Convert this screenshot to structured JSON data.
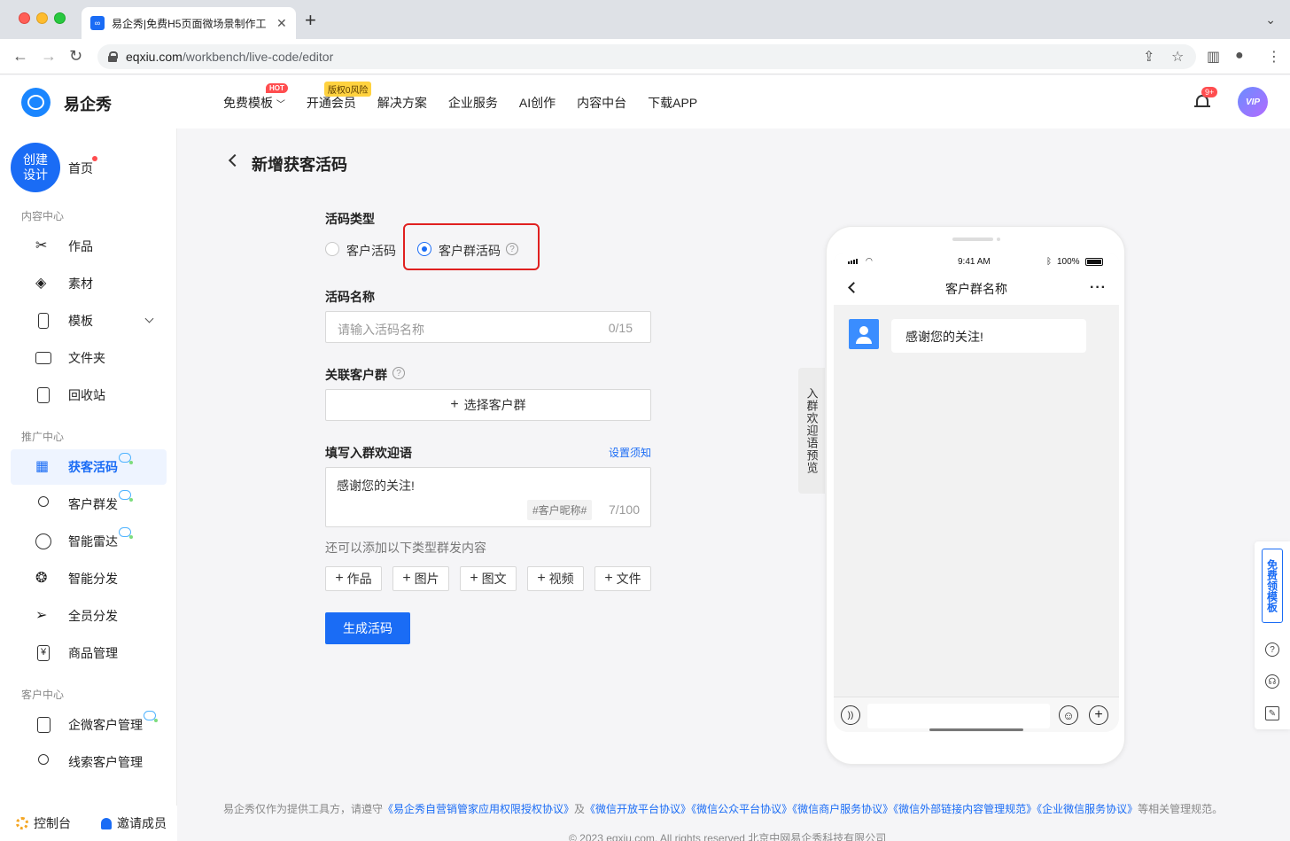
{
  "browser": {
    "tab_title": "易企秀|免费H5页面微场景制作工",
    "favicon_text": "∞",
    "url_host": "eqxiu.com",
    "url_path": "/workbench/live-code/editor"
  },
  "header": {
    "brand": "易企秀",
    "nav": [
      {
        "label": "免费模板",
        "badge": "HOT"
      },
      {
        "label": "开通会员",
        "badge": "版权0风险"
      },
      {
        "label": "解决方案"
      },
      {
        "label": "企业服务"
      },
      {
        "label": "AI创作"
      },
      {
        "label": "内容中台"
      },
      {
        "label": "下载APP"
      }
    ],
    "notification_count": "9+",
    "avatar_text": "VIP"
  },
  "sidebar": {
    "create_button": "创建设计",
    "home": "首页",
    "sections": [
      {
        "title": "内容中心",
        "items": [
          "作品",
          "素材",
          "模板",
          "文件夹",
          "回收站"
        ]
      },
      {
        "title": "推广中心",
        "items": [
          "获客活码",
          "客户群发",
          "智能雷达",
          "智能分发",
          "全员分发",
          "商品管理"
        ]
      },
      {
        "title": "客户中心",
        "items": [
          "企微客户管理",
          "线索客户管理"
        ]
      }
    ],
    "active_item": "获客活码",
    "bottom": {
      "console": "控制台",
      "invite": "邀请成员"
    }
  },
  "form": {
    "page_title": "新增获客活码",
    "code_type_label": "活码类型",
    "code_type_options": [
      "客户活码",
      "客户群活码"
    ],
    "code_type_selected": "客户群活码",
    "name_label": "活码名称",
    "name_placeholder": "请输入活码名称",
    "name_count": "0/15",
    "group_label": "关联客户群",
    "group_button": "选择客户群",
    "welcome_label": "填写入群欢迎语",
    "welcome_link": "设置须知",
    "welcome_value": "感谢您的关注!",
    "nickname_tag": "#客户昵称#",
    "welcome_count": "7/100",
    "hint": "还可以添加以下类型群发内容",
    "add_buttons": [
      "作品",
      "图片",
      "图文",
      "视频",
      "文件"
    ],
    "submit": "生成活码"
  },
  "preview": {
    "tab_label": "入群欢迎语预览",
    "time": "9:41 AM",
    "battery": "100%",
    "chat_title": "客户群名称",
    "message": "感谢您的关注!"
  },
  "float_bar": {
    "free_template": "免费领模板"
  },
  "footer": {
    "prefix": "易企秀仅作为提供工具方，请遵守",
    "links": [
      "《易企秀自营销管家应用权限授权协议》",
      "《微信开放平台协议》",
      "《微信公众平台协议》",
      "《微信商户服务协议》",
      "《微信外部链接内容管理规范》",
      "《企业微信服务协议》"
    ],
    "and": "及",
    "suffix": "等相关管理规范。",
    "copyright": "© 2023 eqxiu.com. All rights reserved 北京中网易企秀科技有限公司"
  }
}
